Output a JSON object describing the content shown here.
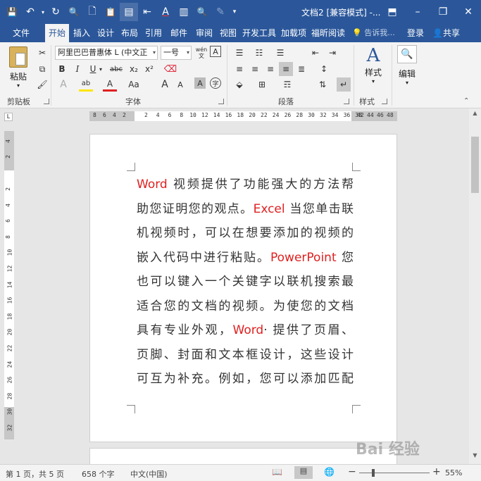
{
  "window": {
    "title": "文档2 [兼容模式] -...",
    "minimize": "–",
    "restore": "❐",
    "close": "✕",
    "ribbon_display": "⬒"
  },
  "qat": {
    "save": "💾",
    "undo": "↶",
    "redo": "↻",
    "print_preview": "🔍",
    "new": "🗋",
    "paste": "📋",
    "view": "▤",
    "format": "⇤",
    "font_color": "A",
    "compare": "▥",
    "find": "🔍",
    "edit": "✎",
    "more": "▾"
  },
  "tabs": [
    {
      "label": "文件"
    },
    {
      "label": "开始"
    },
    {
      "label": "插入"
    },
    {
      "label": "设计"
    },
    {
      "label": "布局"
    },
    {
      "label": "引用"
    },
    {
      "label": "邮件"
    },
    {
      "label": "审阅"
    },
    {
      "label": "视图"
    },
    {
      "label": "开发工具"
    },
    {
      "label": "加载项"
    },
    {
      "label": "福昕阅读"
    }
  ],
  "tellme": "告诉我...",
  "login": "登录",
  "share": "共享",
  "ribbon": {
    "clipboard": {
      "label": "剪贴板",
      "paste": "粘贴"
    },
    "font": {
      "label": "字体",
      "font_name": "阿里巴巴普惠体 L (中文正",
      "font_size": "一号",
      "wen": "wén",
      "bold": "B",
      "italic": "I",
      "underline": "U",
      "strike": "abc",
      "subscript": "x₂",
      "superscript": "x²",
      "grow": "A",
      "shrink": "A",
      "case": "Aa",
      "highlight": "ab",
      "color": "A",
      "char_shade": "A",
      "enclose": "字"
    },
    "paragraph": {
      "label": "段落"
    },
    "styles": {
      "label": "样式",
      "button": "样式"
    },
    "editing": {
      "button": "编辑"
    }
  },
  "ruler": {
    "h_left": [
      "8",
      "6",
      "4",
      "2"
    ],
    "h_main": [
      "2",
      "4",
      "6",
      "8",
      "10",
      "12",
      "14",
      "16",
      "18",
      "20",
      "22",
      "24",
      "26",
      "28",
      "30",
      "32",
      "34",
      "36",
      "38"
    ],
    "h_right": [
      "42",
      "44",
      "46",
      "48"
    ],
    "v": [
      "4",
      "2",
      "2",
      "4",
      "6",
      "8",
      "10",
      "12",
      "14",
      "16",
      "18",
      "20",
      "22",
      "24",
      "26",
      "28",
      "30",
      "32"
    ]
  },
  "document": {
    "lines": [
      [
        {
          "t": "Word",
          "r": true
        },
        {
          "t": " 视频提供了功能强大的方法帮",
          "r": false
        }
      ],
      [
        {
          "t": "助您证明您的观点。",
          "r": false
        },
        {
          "t": "Excel",
          "r": true
        },
        {
          "t": " 当您单击联",
          "r": false
        }
      ],
      [
        {
          "t": "机视频时，可以在想要添加的视频的",
          "r": false
        }
      ],
      [
        {
          "t": "嵌入代码中进行粘贴。",
          "r": false
        },
        {
          "t": "PowerPoint",
          "r": true
        },
        {
          "t": " 您",
          "r": false
        }
      ],
      [
        {
          "t": "也可以键入一个关键字以联机搜索最",
          "r": false
        }
      ],
      [
        {
          "t": "适合您的文档的视频。为使您的文档",
          "r": false
        }
      ],
      [
        {
          "t": "具有专业外观，",
          "r": false
        },
        {
          "t": "Word",
          "r": true
        },
        {
          "t": "· 提供了页眉、",
          "r": false
        }
      ],
      [
        {
          "t": "页脚、封面和文本框设计，这些设计",
          "r": false
        }
      ],
      [
        {
          "t": "可互为补充。例如，您可以添加匹配",
          "r": false
        }
      ]
    ]
  },
  "watermark": "Bai 经验",
  "status": {
    "page": "第 1 页，共 5 页",
    "words": "658 个字",
    "language": "中文(中国)",
    "zoom_minus": "−",
    "zoom_plus": "+",
    "zoom": "55%"
  },
  "colors": {
    "brand": "#2b579a",
    "red_text": "#e02020"
  }
}
